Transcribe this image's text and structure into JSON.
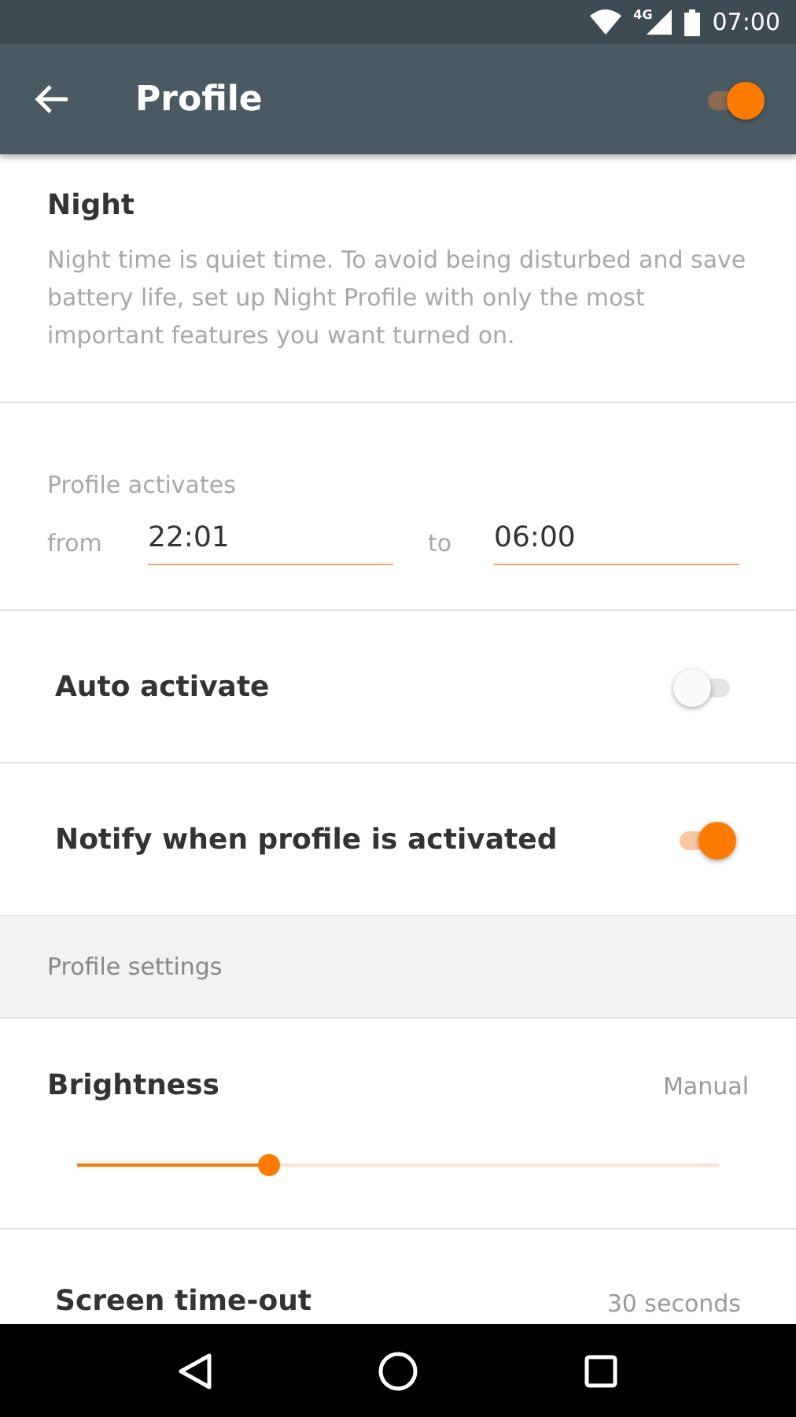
{
  "status_bar": {
    "network": "4G",
    "time": "07:00"
  },
  "app_bar": {
    "title": "Profile",
    "enabled": {
      "on": true
    }
  },
  "intro": {
    "title": "Night",
    "description": "Night time is quiet time. To avoid being disturbed and save battery life, set up Night Profile with only the most important features you want turned on."
  },
  "schedule": {
    "label": "Profile activates",
    "from_label": "from",
    "from_value": "22:01",
    "to_label": "to",
    "to_value": "06:00"
  },
  "toggles": [
    {
      "label": "Auto activate",
      "on": false
    },
    {
      "label": "Notify when profile is activated",
      "on": true
    }
  ],
  "section_header": "Profile settings",
  "brightness": {
    "label": "Brightness",
    "value": "Manual",
    "level": 0.3
  },
  "timeout": {
    "label": "Screen time-out",
    "value": "30 seconds"
  }
}
